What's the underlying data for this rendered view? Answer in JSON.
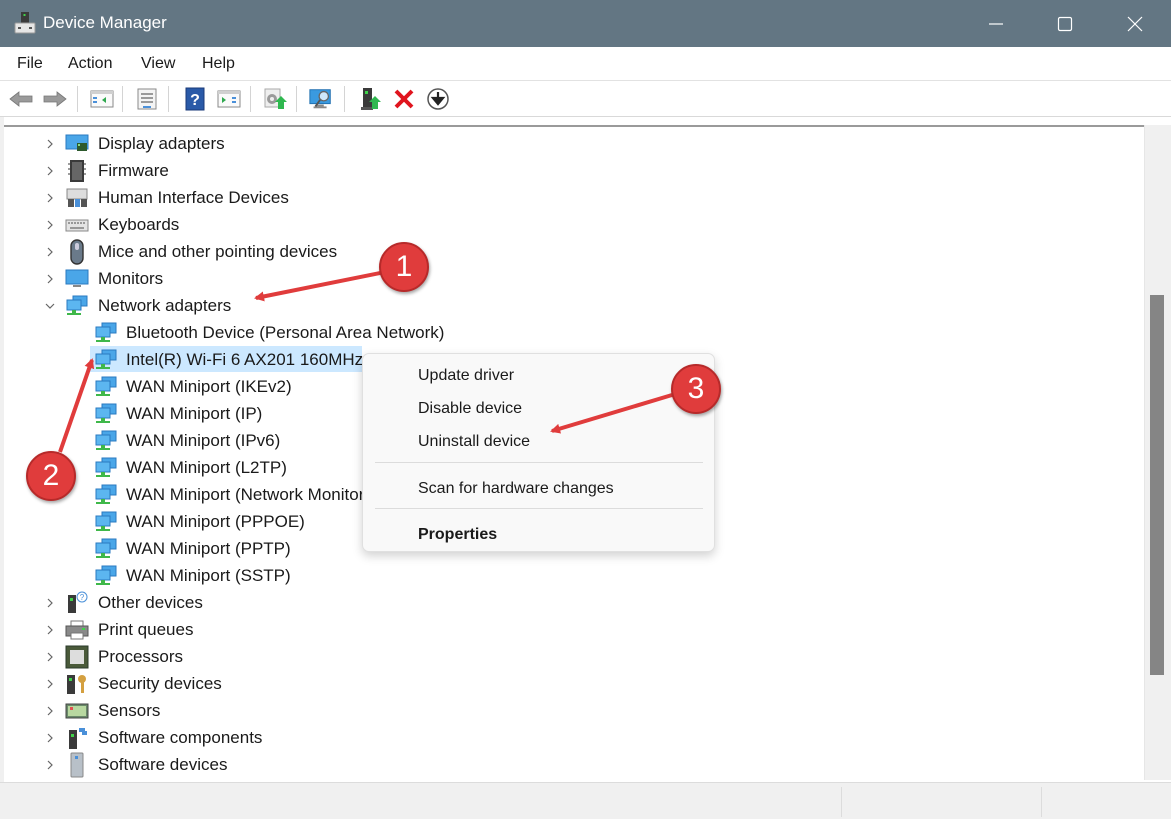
{
  "window": {
    "title": "Device Manager",
    "controls": {
      "minimize": "minimize",
      "maximize": "maximize",
      "close": "close"
    }
  },
  "menubar": {
    "items": [
      {
        "label": "File"
      },
      {
        "label": "Action"
      },
      {
        "label": "View"
      },
      {
        "label": "Help"
      }
    ]
  },
  "toolbar": {
    "buttons": [
      {
        "name": "back",
        "icon": "arrow-left-icon"
      },
      {
        "name": "forward",
        "icon": "arrow-right-icon"
      },
      {
        "name": "show-hide-console-tree",
        "icon": "console-tree-icon"
      },
      {
        "name": "properties",
        "icon": "properties-sheet-icon"
      },
      {
        "name": "help",
        "icon": "help-icon"
      },
      {
        "name": "show-hide-action-pane",
        "icon": "action-pane-icon"
      },
      {
        "name": "update-driver",
        "icon": "update-driver-icon"
      },
      {
        "name": "scan-hardware-changes",
        "icon": "scan-monitor-icon"
      },
      {
        "name": "add-legacy-hardware",
        "icon": "add-hardware-icon"
      },
      {
        "name": "uninstall-device",
        "icon": "uninstall-x-icon"
      },
      {
        "name": "disable-device",
        "icon": "disable-device-icon"
      }
    ]
  },
  "tree": {
    "categories_before": [
      {
        "label": "Display adapters",
        "icon": "display-adapter-icon",
        "expanded": false
      },
      {
        "label": "Firmware",
        "icon": "firmware-chip-icon",
        "expanded": false
      },
      {
        "label": "Human Interface Devices",
        "icon": "hid-icon",
        "expanded": false
      },
      {
        "label": "Keyboards",
        "icon": "keyboard-icon",
        "expanded": false
      },
      {
        "label": "Mice and other pointing devices",
        "icon": "mouse-icon",
        "expanded": false
      },
      {
        "label": "Monitors",
        "icon": "monitor-icon",
        "expanded": false
      },
      {
        "label": "Network adapters",
        "icon": "network-adapter-icon",
        "expanded": true
      }
    ],
    "network_children": [
      {
        "label": "Bluetooth Device (Personal Area Network)",
        "selected": false
      },
      {
        "label": "Intel(R) Wi-Fi 6 AX201 160MHz",
        "selected": true
      },
      {
        "label": "WAN Miniport (IKEv2)",
        "selected": false
      },
      {
        "label": "WAN Miniport (IP)",
        "selected": false
      },
      {
        "label": "WAN Miniport (IPv6)",
        "selected": false
      },
      {
        "label": "WAN Miniport (L2TP)",
        "selected": false
      },
      {
        "label": "WAN Miniport (Network Monitor)",
        "selected": false
      },
      {
        "label": "WAN Miniport (PPPOE)",
        "selected": false
      },
      {
        "label": "WAN Miniport (PPTP)",
        "selected": false
      },
      {
        "label": "WAN Miniport (SSTP)",
        "selected": false
      }
    ],
    "categories_after": [
      {
        "label": "Other devices",
        "icon": "other-devices-icon",
        "expanded": false
      },
      {
        "label": "Print queues",
        "icon": "printer-icon",
        "expanded": false
      },
      {
        "label": "Processors",
        "icon": "processor-icon",
        "expanded": false
      },
      {
        "label": "Security devices",
        "icon": "security-key-icon",
        "expanded": false
      },
      {
        "label": "Sensors",
        "icon": "sensor-icon",
        "expanded": false
      },
      {
        "label": "Software components",
        "icon": "software-component-icon",
        "expanded": false
      },
      {
        "label": "Software devices",
        "icon": "software-device-icon",
        "expanded": false
      }
    ]
  },
  "context_menu": {
    "items": [
      {
        "label": "Update driver",
        "bold": false
      },
      {
        "label": "Disable device",
        "bold": false
      },
      {
        "label": "Uninstall device",
        "bold": false
      },
      {
        "label": "Scan for hardware changes",
        "bold": false
      },
      {
        "label": "Properties",
        "bold": true
      }
    ]
  },
  "annotations": [
    {
      "number": "1",
      "target": "Network adapters"
    },
    {
      "number": "2",
      "target": "Intel(R) Wi-Fi 6 AX201 160MHz"
    },
    {
      "number": "3",
      "target": "Uninstall device"
    }
  ],
  "colors": {
    "titlebar": "#637683",
    "selection": "#cce8ff",
    "annotation_red": "#e03c3c",
    "uninstall_red": "#e0141e"
  }
}
